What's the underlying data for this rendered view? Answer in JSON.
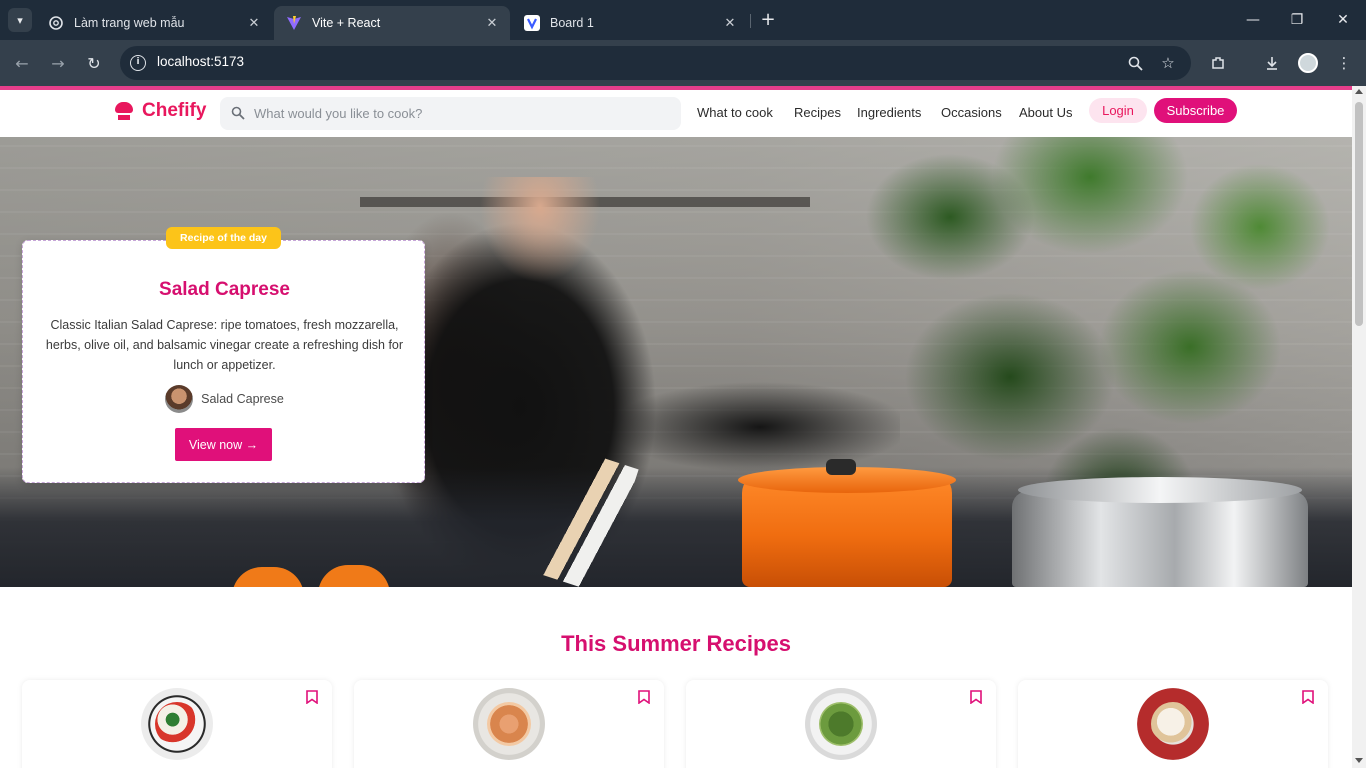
{
  "browser": {
    "tabs": [
      {
        "title": "Làm trang web mẫu",
        "active": false
      },
      {
        "title": "Vite + React",
        "active": true
      },
      {
        "title": "Board 1",
        "active": false
      }
    ],
    "url": "localhost:5173",
    "colors": {
      "tabstrip": "#1f2c3a",
      "toolbar": "#34404c"
    }
  },
  "site": {
    "logo": "Chefify",
    "search_placeholder": "What would you like to cook?",
    "nav": [
      "What to cook",
      "Recipes",
      "Ingredients",
      "Occasions",
      "About Us"
    ],
    "login_label": "Login",
    "subscribe_label": "Subscribe",
    "colors": {
      "brand": "#e8175d",
      "primary_button": "#e0107a",
      "badge": "#fcc419"
    }
  },
  "hero": {
    "badge": "Recipe of the day",
    "title": "Salad Caprese",
    "description": "Classic Italian Salad Caprese: ripe tomatoes, fresh mozzarella, herbs, olive oil, and balsamic vinegar create a refreshing dish for lunch or appetizer.",
    "author": "Salad Caprese",
    "cta": "View now →"
  },
  "summer": {
    "title": "This Summer Recipes",
    "cards": [
      {
        "dish": "caprese-salad-dish",
        "icon": "bookmark-icon"
      },
      {
        "dish": "shrimp-pasta-dish",
        "icon": "bookmark-icon"
      },
      {
        "dish": "green-salad-dish",
        "icon": "bookmark-icon"
      },
      {
        "dish": "cake-slice-dish",
        "icon": "bookmark-icon"
      }
    ]
  }
}
